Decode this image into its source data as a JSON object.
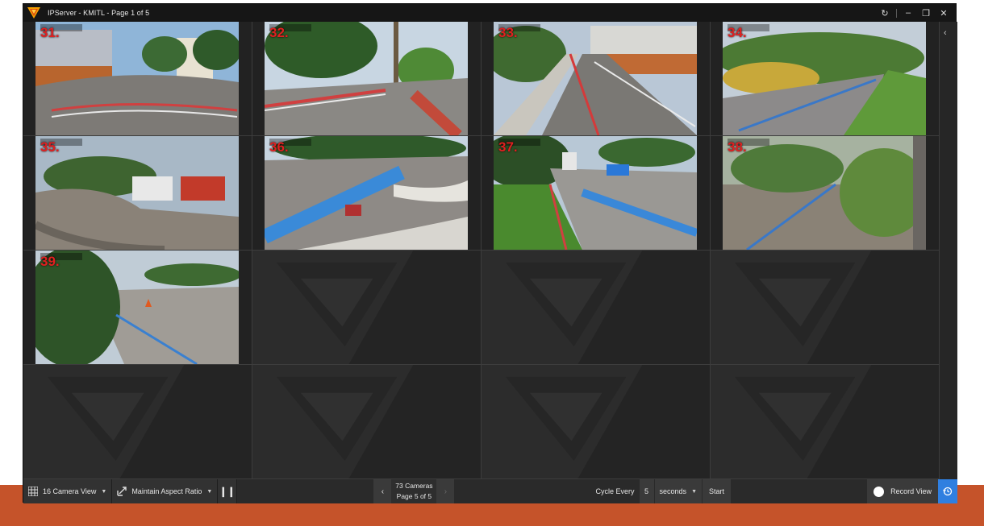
{
  "window": {
    "title": "IPServer - KMITL - Page 1 of 5",
    "controls": [
      "refresh-icon",
      "minimize-icon",
      "restore-icon",
      "close-icon"
    ]
  },
  "colors": {
    "camera_label": "#e02020",
    "accent_blue": "#2f7fe0",
    "slide_band": "#c5532a"
  },
  "cameras": [
    {
      "label": "31."
    },
    {
      "label": "32."
    },
    {
      "label": "33."
    },
    {
      "label": "34."
    },
    {
      "label": "35."
    },
    {
      "label": "36."
    },
    {
      "label": "37."
    },
    {
      "label": "38."
    },
    {
      "label": "39."
    }
  ],
  "empty_slots": 7,
  "toolbar": {
    "view_label": "16 Camera View",
    "aspect_label": "Maintain Aspect Ratio",
    "pager_count": "73 Cameras",
    "pager_page": "Page 5 of 5",
    "cycle_label": "Cycle Every",
    "cycle_value": "5",
    "cycle_unit": "seconds",
    "start_label": "Start",
    "record_label": "Record View"
  }
}
